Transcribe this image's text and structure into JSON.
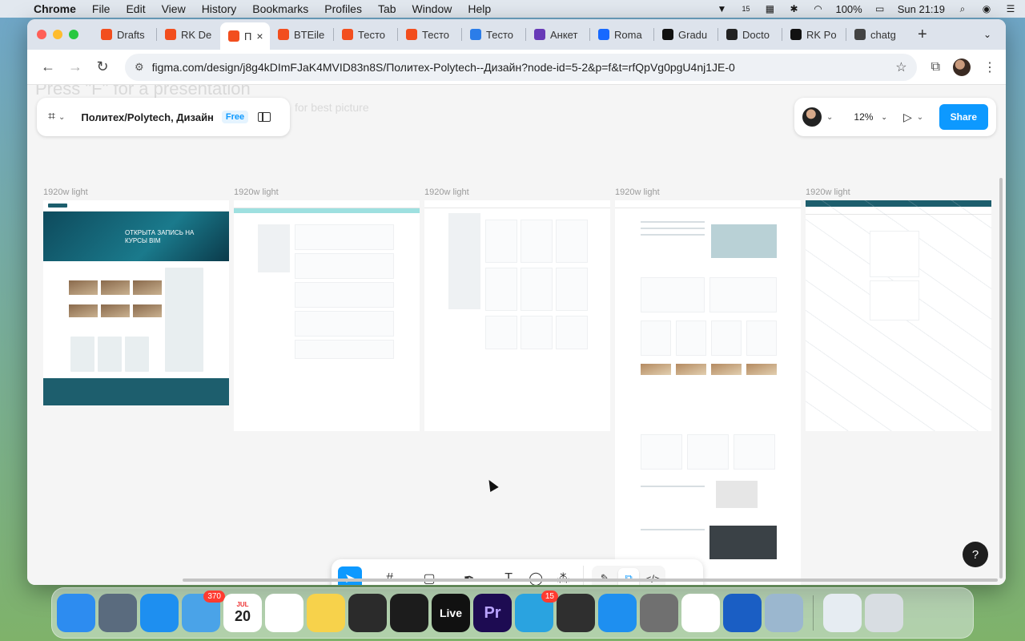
{
  "menubar": {
    "app": "Chrome",
    "items": [
      "File",
      "Edit",
      "View",
      "History",
      "Bookmarks",
      "Profiles",
      "Tab",
      "Window",
      "Help"
    ],
    "battery": "100%",
    "clock": "Sun 21:19",
    "notif_count": "15"
  },
  "tabs": [
    {
      "label": "Drafts",
      "favicon": "figma",
      "color": "#f24e1e"
    },
    {
      "label": "RK De",
      "favicon": "figma",
      "color": "#f24e1e"
    },
    {
      "label": "П",
      "favicon": "figma",
      "color": "#f24e1e",
      "active": true
    },
    {
      "label": "BTEile",
      "favicon": "figma",
      "color": "#f24e1e"
    },
    {
      "label": "Тесто",
      "favicon": "figma",
      "color": "#f24e1e"
    },
    {
      "label": "Тесто",
      "favicon": "figma",
      "color": "#f24e1e"
    },
    {
      "label": "Тесто",
      "favicon": "pi",
      "color": "#2b7de9"
    },
    {
      "label": "Анкет",
      "favicon": "forms",
      "color": "#673ab7"
    },
    {
      "label": "Roma",
      "favicon": "behance",
      "color": "#1769ff"
    },
    {
      "label": "Gradu",
      "favicon": "gradient",
      "color": "#111111"
    },
    {
      "label": "Docto",
      "favicon": "docs",
      "color": "#222222"
    },
    {
      "label": "RK Po",
      "favicon": "rk",
      "color": "#111111"
    },
    {
      "label": "chatg",
      "favicon": "openai",
      "color": "#444444"
    }
  ],
  "toolbar": {
    "url": "figma.com/design/j8g4kDImFJaK4MVID83n8S/Политех-Polytech--Дизайн?node-id=5-2&p=f&t=rfQpVg0pgU4nj1JE-0"
  },
  "figma": {
    "file_name": "Политех/Polytech, Дизайн",
    "plan_badge": "Free",
    "zoom": "12%",
    "share_label": "Share",
    "ghost_text": "Press \"F\" for a presentation",
    "ghost_text2": "for best picture",
    "frames": [
      {
        "label": "1920w light",
        "hero": "ОТКРЫТА ЗАПИСЬ НА КУРСЫ BIM"
      },
      {
        "label": "1920w light"
      },
      {
        "label": "1920w light"
      },
      {
        "label": "1920w light"
      },
      {
        "label": "1920w light"
      }
    ],
    "help": "?"
  },
  "dock": [
    {
      "name": "finder",
      "color": "#2d8cf0",
      "label": ""
    },
    {
      "name": "launchpad",
      "color": "#5a6b7e",
      "label": ""
    },
    {
      "name": "safari",
      "color": "#1e8ff0",
      "label": ""
    },
    {
      "name": "mail",
      "color": "#4aa3e8",
      "label": "",
      "badge": "370"
    },
    {
      "name": "calendar",
      "color": "#ffffff",
      "label": "20",
      "month": "JUL"
    },
    {
      "name": "photos",
      "color": "#ffffff",
      "label": ""
    },
    {
      "name": "notes",
      "color": "#f7d24b",
      "label": ""
    },
    {
      "name": "obs",
      "color": "#2b2b2b",
      "label": ""
    },
    {
      "name": "xcode-like",
      "color": "#1c1c1c",
      "label": ""
    },
    {
      "name": "live",
      "color": "#111111",
      "label": "Live"
    },
    {
      "name": "premiere",
      "color": "#1d0b52",
      "label": "Pr"
    },
    {
      "name": "telegram",
      "color": "#2aa3e0",
      "label": "",
      "badge": "15"
    },
    {
      "name": "whatsapp",
      "color": "#2f2f2f",
      "label": ""
    },
    {
      "name": "app-store",
      "color": "#1e8ff0",
      "label": ""
    },
    {
      "name": "system-settings",
      "color": "#707070",
      "label": ""
    },
    {
      "name": "chrome",
      "color": "#ffffff",
      "label": ""
    },
    {
      "name": "word",
      "color": "#1a5ec4",
      "label": ""
    },
    {
      "name": "preview",
      "color": "#9bb7cf",
      "label": ""
    },
    {
      "name": "downloads-stack",
      "color": "#e6ecf2",
      "label": ""
    },
    {
      "name": "trash",
      "color": "#d8dde2",
      "label": ""
    }
  ]
}
